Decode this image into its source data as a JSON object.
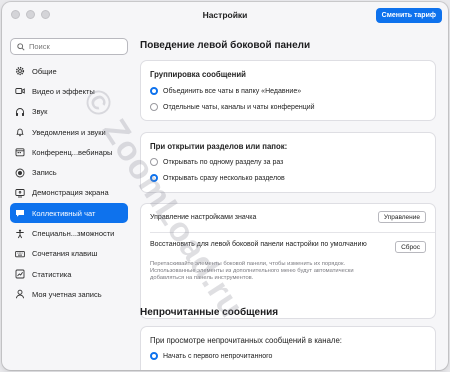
{
  "window": {
    "title": "Настройки",
    "upgrade_button": "Сменить тариф"
  },
  "search": {
    "placeholder": "Поиск"
  },
  "sidebar": {
    "items": [
      {
        "label": "Общие",
        "icon": "gear-icon",
        "active": false
      },
      {
        "label": "Видео и эффекты",
        "icon": "video-icon",
        "active": false
      },
      {
        "label": "Звук",
        "icon": "headphones-icon",
        "active": false
      },
      {
        "label": "Уведомления и звуки",
        "icon": "bell-icon",
        "active": false
      },
      {
        "label": "Конференц...вебинары",
        "icon": "calendar-icon",
        "active": false
      },
      {
        "label": "Запись",
        "icon": "record-icon",
        "active": false
      },
      {
        "label": "Демонстрация экрана",
        "icon": "screen-share-icon",
        "active": false
      },
      {
        "label": "Коллективный чат",
        "icon": "chat-icon",
        "active": true
      },
      {
        "label": "Специальн...зможности",
        "icon": "accessibility-icon",
        "active": false
      },
      {
        "label": "Сочетания клавиш",
        "icon": "keyboard-icon",
        "active": false
      },
      {
        "label": "Статистика",
        "icon": "stats-icon",
        "active": false
      },
      {
        "label": "Моя учетная запись",
        "icon": "person-icon",
        "active": false
      }
    ]
  },
  "main": {
    "section1_title": "Поведение левой боковой панели",
    "grouping": {
      "heading": "Группировка сообщений",
      "options": [
        {
          "label": "Объединить все чаты в папку «Недавние»",
          "selected": true
        },
        {
          "label": "Отдельные чаты, каналы и чаты конференций",
          "selected": false
        }
      ]
    },
    "folders": {
      "heading": "При открытии разделов или папок:",
      "options": [
        {
          "label": "Открывать по одному разделу за раз",
          "selected": false
        },
        {
          "label": "Открывать сразу несколько разделов",
          "selected": true
        }
      ]
    },
    "icon_settings": {
      "label": "Управление настройками значка",
      "button": "Управление"
    },
    "reset": {
      "label": "Восстановить для левой боковой панели настройки по умолчанию",
      "button": "Сброс",
      "description": "Перетаскивайте элементы боковой панели, чтобы изменить их порядок. Использованные элементы из дополнительного меню будут автоматически добавляться на панель инструментов."
    },
    "section2_title": "Непрочитанные сообщения",
    "unread": {
      "heading": "При просмотре непрочитанных сообщений в канале:",
      "options": [
        {
          "label": "Начать с первого непрочитанного",
          "selected": true
        }
      ]
    }
  },
  "watermark": "© ZoomLoad.ru",
  "colors": {
    "accent": "#0e72ed",
    "window_bg": "#f6f6f8",
    "card_bg": "#ffffff"
  }
}
